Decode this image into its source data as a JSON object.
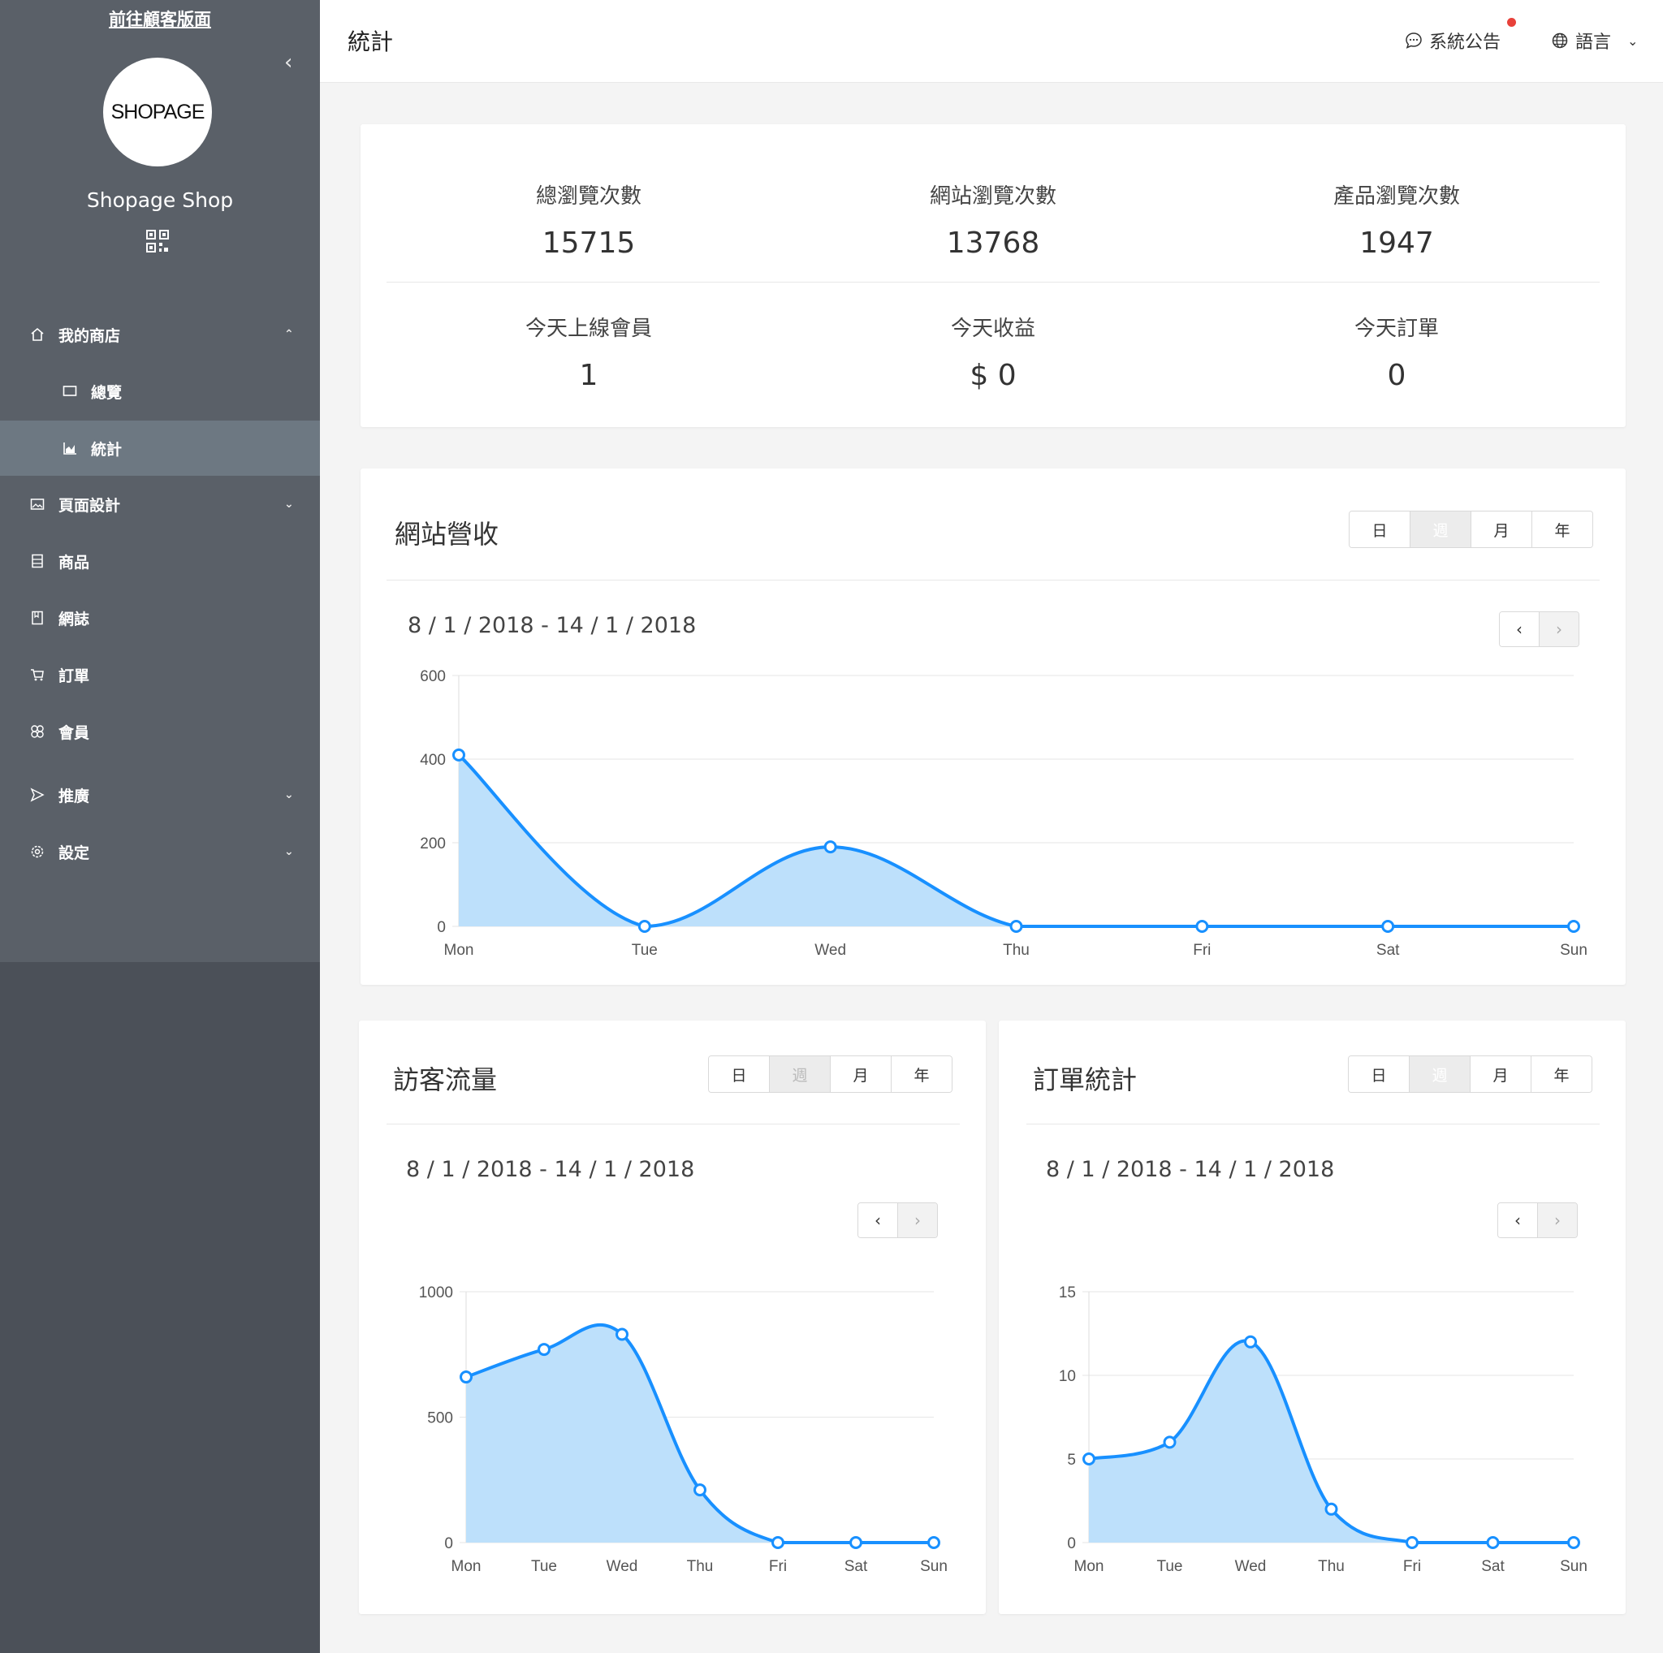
{
  "sidebar": {
    "visit_link": "前往顧客版面",
    "logo_text": "SHOPAGE",
    "shop_name": "Shopage Shop",
    "items": [
      {
        "label": "我的商店"
      },
      {
        "label": "總覽"
      },
      {
        "label": "統計"
      },
      {
        "label": "頁面設計"
      },
      {
        "label": "商品"
      },
      {
        "label": "網誌"
      },
      {
        "label": "訂單"
      },
      {
        "label": "會員"
      },
      {
        "label": "推廣"
      },
      {
        "label": "設定"
      }
    ]
  },
  "header": {
    "title": "統計",
    "notice_label": "系統公告",
    "language_label": "語言"
  },
  "stats": [
    {
      "label": "總瀏覽次數",
      "value": "15715"
    },
    {
      "label": "網站瀏覽次數",
      "value": "13768"
    },
    {
      "label": "產品瀏覽次數",
      "value": "1947"
    },
    {
      "label": "今天上線會員",
      "value": "1"
    },
    {
      "label": "今天收益",
      "value": "$ 0"
    },
    {
      "label": "今天訂單",
      "value": "0"
    }
  ],
  "period_options": [
    "日",
    "週",
    "月",
    "年"
  ],
  "selected_period": "週",
  "revenue_card": {
    "title": "網站營收",
    "date_range": "8 / 1 / 2018 - 14 / 1 / 2018"
  },
  "visitor_card": {
    "title": "訪客流量",
    "date_range": "8 / 1 / 2018 - 14 / 1 / 2018"
  },
  "order_card": {
    "title": "訂單統計",
    "date_range": "8 / 1 / 2018 - 14 / 1 / 2018"
  },
  "colors": {
    "line": "#1890ff",
    "fill": "#bde0fb",
    "sidebar": "#4b5058",
    "active": "#6d7882",
    "notice_dot": "#e8413a"
  },
  "chart_data": [
    {
      "type": "area",
      "title": "網站營收",
      "categories": [
        "Mon",
        "Tue",
        "Wed",
        "Thu",
        "Fri",
        "Sat",
        "Sun"
      ],
      "values": [
        410,
        0,
        190,
        0,
        0,
        0,
        0
      ],
      "ylim": [
        0,
        600
      ],
      "yticks": [
        0,
        200,
        400,
        600
      ],
      "grid": true
    },
    {
      "type": "area",
      "title": "訪客流量",
      "categories": [
        "Mon",
        "Tue",
        "Wed",
        "Thu",
        "Fri",
        "Sat",
        "Sun"
      ],
      "values": [
        660,
        770,
        830,
        210,
        0,
        0,
        0
      ],
      "ylim": [
        0,
        1000
      ],
      "yticks": [
        0,
        500,
        1000
      ],
      "grid": true
    },
    {
      "type": "area",
      "title": "訂單統計",
      "categories": [
        "Mon",
        "Tue",
        "Wed",
        "Thu",
        "Fri",
        "Sat",
        "Sun"
      ],
      "values": [
        5,
        6,
        12,
        2,
        0,
        0,
        0
      ],
      "ylim": [
        0,
        15
      ],
      "yticks": [
        0,
        5,
        10,
        15
      ],
      "grid": true
    }
  ]
}
